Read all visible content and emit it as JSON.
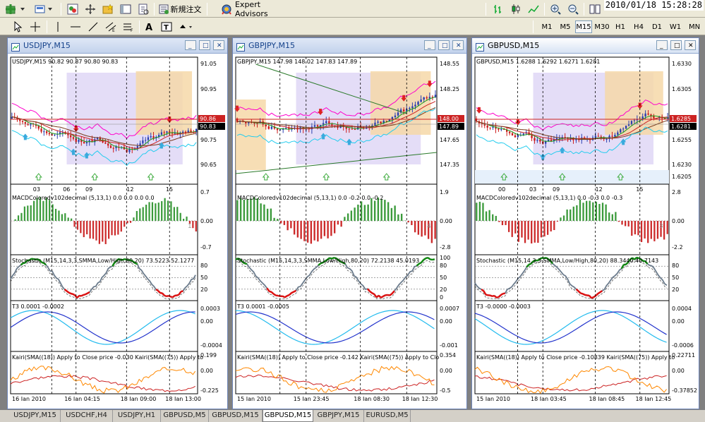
{
  "toolbar": {
    "new_order_label": "新規注文",
    "expert_advisors_label": "Expert Advisors",
    "clock": "2010/01/18 15:28:28",
    "timeframes": [
      "M1",
      "M5",
      "M15",
      "M30",
      "H1",
      "H4",
      "D1",
      "W1",
      "MN"
    ],
    "active_timeframe": "M15"
  },
  "windows": [
    {
      "title": "USDJPY,M15",
      "active": false,
      "main": {
        "header": "USDJPY,M15  90.82 90.87 90.80 90.83",
        "yticks": [
          "91.05",
          "90.95",
          "90.75",
          "90.65"
        ],
        "price_boxes": [
          {
            "text": "90.86",
            "color": "#cc2222"
          },
          {
            "text": "90.83",
            "color": "#000000"
          }
        ],
        "xticks": [
          "03",
          "06",
          "09",
          "12",
          "15"
        ]
      },
      "macd": {
        "header": "MACDColoredv102decimal (5,13,1) 0.0 0.0 0.0 0.0",
        "yticks": [
          "0.7",
          "0.00",
          "-0.7"
        ],
        "right_label": "1"
      },
      "stoch": {
        "header": "Stochastic (M15,14,3,3,SMMA,Low/High,80,20) 73.5223 52.1277",
        "yticks": [
          "80",
          "50",
          "20"
        ]
      },
      "t3": {
        "header": "T3 0.0001 -0.0002",
        "yticks": [
          "0.0003",
          "0.00",
          "-0.0004"
        ]
      },
      "kairi": {
        "header": "Kairi(SMA((18)) Apply to Close price -0.030  Kairi(SMA((75)) Apply to",
        "yticks": [
          "0.199",
          "0.00",
          "-0.225"
        ]
      },
      "bottom_axis": [
        "16 Jan 2010",
        "16 Jan 04:15",
        "18 Jan 09:00",
        "18 Jan 13:00"
      ]
    },
    {
      "title": "GBPJPY,M15",
      "active": false,
      "main": {
        "header": "GBPJPY,M15  147.98 148.02 147.83 147.89",
        "yticks": [
          "148.55",
          "148.25",
          "147.65",
          "147.35"
        ],
        "price_boxes": [
          {
            "text": "148.00",
            "color": "#cc2222"
          },
          {
            "text": "147.89",
            "color": "#000000"
          }
        ],
        "xticks": []
      },
      "macd": {
        "header": "MACDColoredv102decimal (5,13,1) 0.0 -0.2 0.0 -0.2",
        "yticks": [
          "1.9",
          "0.00",
          "-2.8"
        ],
        "right_label": "4"
      },
      "stoch": {
        "header": "Stochastic (M15,14,3,3,SMMA,Low/High,80,20) 72.2138 45.0193",
        "yticks": [
          "100",
          "80",
          "50",
          "20",
          "0"
        ]
      },
      "t3": {
        "header": "T3 0.0001 -0.0005",
        "yticks": [
          "0.0007",
          "0.00",
          "-0.001"
        ]
      },
      "kairi": {
        "header": "Kairi(SMA((18)) Apply to Close price -0.142  Kairi(SMA((75)) Apply to Clo",
        "yticks": [
          "0.354",
          "0.00",
          "-0.5"
        ]
      },
      "bottom_axis": [
        "15 Jan 2010",
        "15 Jan 23:45",
        "18 Jan 08:30",
        "18 Jan 12:30"
      ]
    },
    {
      "title": "GBPUSD,M15",
      "active": true,
      "main": {
        "header": "GBPUSD,M15  1.6288 1.6292 1.6271 1.6281",
        "yticks": [
          "1.6330",
          "1.6305",
          "1.6255",
          "1.6230",
          "1.6205"
        ],
        "price_boxes": [
          {
            "text": "1.6285",
            "color": "#cc2222"
          },
          {
            "text": "1.6281",
            "color": "#000000"
          }
        ],
        "xticks": [
          "00",
          "03",
          "09",
          "12",
          "15"
        ]
      },
      "macd": {
        "header": "MACDColoredv102decimal (5,13,1) 0.0 -0.3 0.0 -0.3",
        "yticks": [
          "2.8",
          "0.00",
          "-2.2"
        ],
        "right_label": "3"
      },
      "stoch": {
        "header": "Stochastic (M15,14,3,3,SMMA,Low/High,80,20) 88.3440 40.7143",
        "yticks": [
          "80",
          "50",
          "20"
        ]
      },
      "t3": {
        "header": "T3 -0.0000 -0.0003",
        "yticks": [
          "0.0004",
          "0.00",
          "-0.0006"
        ]
      },
      "kairi": {
        "header": "Kairi(SMA((18)) Apply to Close price -0.10839  Kairi(SMA((75)) Apply to",
        "yticks": [
          "0.22711",
          "0.00",
          "-0.37852"
        ]
      },
      "bottom_axis": [
        "15 Jan 2010",
        "18 Jan 03:45",
        "18 Jan 08:45",
        "18 Jan 12:45"
      ]
    }
  ],
  "tabs": [
    "USDJPY,M15",
    "USDCHF,H4",
    "USDJPY,H1",
    "GBPUSD,M5",
    "GBPUSD,M15",
    "GBPUSD,M15",
    "GBPJPY,M15",
    "EURUSD,M5"
  ],
  "active_tab": 5,
  "colors": {
    "bull_candle": "#2a3fb0",
    "bear_candle": "#cc1a1a",
    "macd_up": "#3a9a3a",
    "macd_down": "#cc2a2a",
    "stoch_main": "#6b7b8c",
    "t3_a": "#2233cc",
    "t3_b": "#22bbee",
    "kairi_a": "#ff8800",
    "kairi_b": "#cc2222",
    "zone_purple": "#ddd4f5",
    "zone_orange": "#f6d8a8"
  }
}
